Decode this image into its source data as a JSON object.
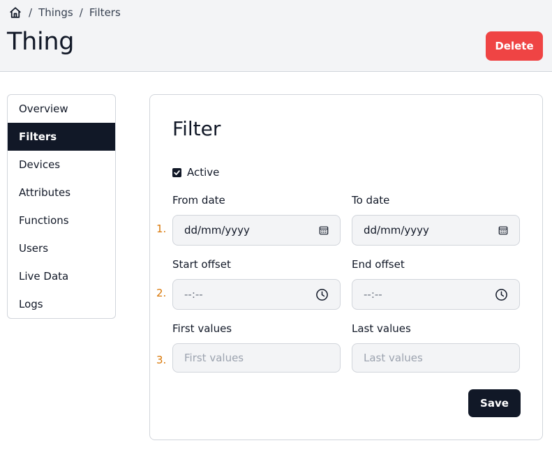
{
  "breadcrumb": {
    "home_icon": "home-icon",
    "separator": "/",
    "items": [
      "Things",
      "Filters"
    ]
  },
  "header": {
    "title": "Thing",
    "delete_label": "Delete",
    "delete_color": "#ef4444"
  },
  "sidebar": {
    "items": [
      {
        "label": "Overview",
        "active": false
      },
      {
        "label": "Filters",
        "active": true
      },
      {
        "label": "Devices",
        "active": false
      },
      {
        "label": "Attributes",
        "active": false
      },
      {
        "label": "Functions",
        "active": false
      },
      {
        "label": "Users",
        "active": false
      },
      {
        "label": "Live Data",
        "active": false
      },
      {
        "label": "Logs",
        "active": false
      }
    ]
  },
  "form": {
    "title": "Filter",
    "active": {
      "label": "Active",
      "checked": true
    },
    "rows": [
      {
        "number": "1.",
        "left": {
          "label": "From date",
          "value": "dd/mm/yyyy",
          "icon": "calendar-icon"
        },
        "right": {
          "label": "To date",
          "value": "dd/mm/yyyy",
          "icon": "calendar-icon"
        }
      },
      {
        "number": "2.",
        "left": {
          "label": "Start offset",
          "value": "--:--",
          "icon": "clock-icon"
        },
        "right": {
          "label": "End offset",
          "value": "--:--",
          "icon": "clock-icon"
        }
      },
      {
        "number": "3.",
        "left": {
          "label": "First values",
          "placeholder": "First values"
        },
        "right": {
          "label": "Last values",
          "placeholder": "Last values"
        }
      }
    ],
    "save_label": "Save"
  },
  "colors": {
    "header_bg": "#f3f4f6",
    "active_nav_bg": "#111827",
    "number_color": "#d97706",
    "field_bg": "#f3f4f6"
  }
}
